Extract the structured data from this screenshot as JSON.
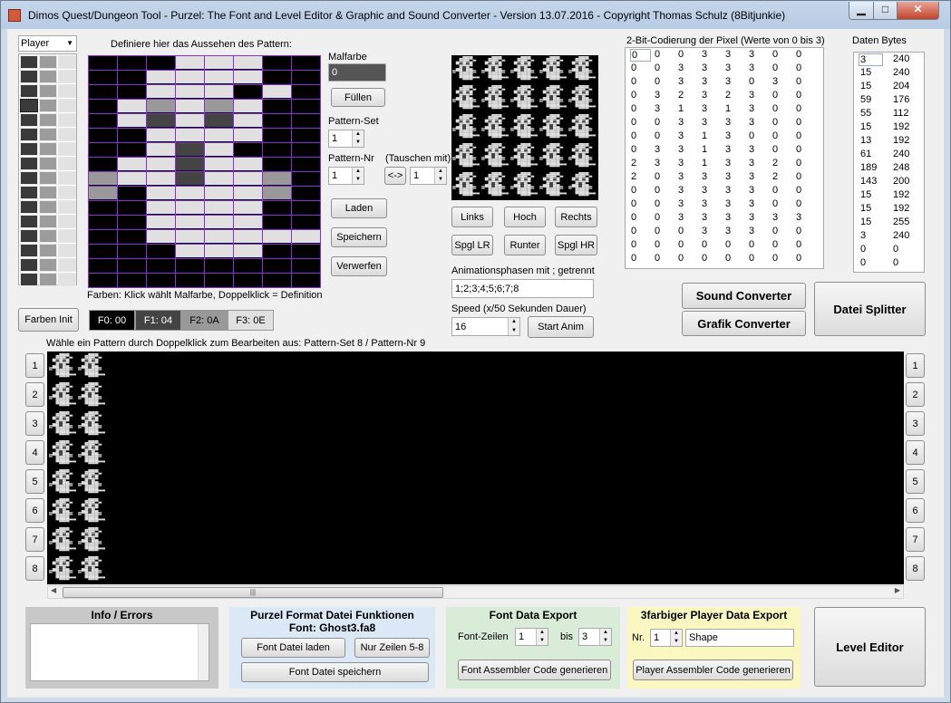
{
  "window": {
    "title": "Dimos Quest/Dungeon Tool  -  Purzel: The Font and Level Editor & Graphic and Sound Converter - Version 13.07.2016 - Copyright Thomas Schulz (8Bitjunkie)",
    "min_glyph": "▁",
    "max_glyph": "□",
    "close_glyph": "✕"
  },
  "player_select": {
    "value": "Player",
    "arrow": "▼"
  },
  "editor": {
    "heading": "Definiere hier das Aussehen des Pattern:",
    "colors_hint": "Farben: Klick wählt Malfarbe, Doppelklick = Definition",
    "grid_rows": [
      "00033300",
      "00333300",
      "00333030",
      "03232300",
      "03131300",
      "00333300",
      "00313000",
      "03313300",
      "23313320",
      "20333320",
      "00333300",
      "00333300",
      "00333333",
      "00033300",
      "00000000",
      "00000000"
    ]
  },
  "palette_colors": {
    "c0": "#000000",
    "c1": "#444444",
    "c2": "#999999",
    "c3": "#e0e0e0",
    "grid_line": "#8a2be2"
  },
  "controls": {
    "malfarbe_label": "Malfarbe",
    "malfarbe_value": "0",
    "fuellen": "Füllen",
    "pattern_set_label": "Pattern-Set",
    "pattern_set_value": "1",
    "pattern_nr_label": "Pattern-Nr",
    "pattern_nr_value": "1",
    "tauschen_label": "(Tauschen mit)",
    "swap_button": "<->",
    "swap_value": "1",
    "laden": "Laden",
    "speichern": "Speichern",
    "verwerfen": "Verwerfen",
    "farben_init": "Farben Init",
    "spin_up": "▲",
    "spin_down": "▼"
  },
  "color_buttons": [
    {
      "label": "F0: 00",
      "bg": "#000000",
      "fg": "#ffffff"
    },
    {
      "label": "F1: 04",
      "bg": "#444444",
      "fg": "#ffffff"
    },
    {
      "label": "F2: 0A",
      "bg": "#999999",
      "fg": "#000000"
    },
    {
      "label": "F3: 0E",
      "bg": "#e0e0e0",
      "fg": "#000000"
    }
  ],
  "shift_buttons": {
    "links": "Links",
    "hoch": "Hoch",
    "rechts": "Rechts",
    "spgl_lr": "Spgl LR",
    "runter": "Runter",
    "spgl_hr": "Spgl HR"
  },
  "animation": {
    "label": "Animationsphasen mit ; getrennt",
    "value": "1;2;3;4;5;6;7;8",
    "speed_label": "Speed (x/50 Sekunden Dauer)",
    "speed_value": "16",
    "start_button": "Start Anim"
  },
  "coding": {
    "heading": "2-Bit-Codierung der Pixel (Werte von 0 bis 3)",
    "rows": [
      [
        "0",
        "0",
        "0",
        "3",
        "3",
        "3",
        "0",
        "0"
      ],
      [
        "0",
        "0",
        "3",
        "3",
        "3",
        "3",
        "0",
        "0"
      ],
      [
        "0",
        "0",
        "3",
        "3",
        "3",
        "0",
        "3",
        "0"
      ],
      [
        "0",
        "3",
        "2",
        "3",
        "2",
        "3",
        "0",
        "0"
      ],
      [
        "0",
        "3",
        "1",
        "3",
        "1",
        "3",
        "0",
        "0"
      ],
      [
        "0",
        "0",
        "3",
        "3",
        "3",
        "3",
        "0",
        "0"
      ],
      [
        "0",
        "0",
        "3",
        "1",
        "3",
        "0",
        "0",
        "0"
      ],
      [
        "0",
        "3",
        "3",
        "1",
        "3",
        "3",
        "0",
        "0"
      ],
      [
        "2",
        "3",
        "3",
        "1",
        "3",
        "3",
        "2",
        "0"
      ],
      [
        "2",
        "0",
        "3",
        "3",
        "3",
        "3",
        "2",
        "0"
      ],
      [
        "0",
        "0",
        "3",
        "3",
        "3",
        "3",
        "0",
        "0"
      ],
      [
        "0",
        "0",
        "3",
        "3",
        "3",
        "3",
        "0",
        "0"
      ],
      [
        "0",
        "0",
        "3",
        "3",
        "3",
        "3",
        "3",
        "3"
      ],
      [
        "0",
        "0",
        "0",
        "3",
        "3",
        "3",
        "0",
        "0"
      ],
      [
        "0",
        "0",
        "0",
        "0",
        "0",
        "0",
        "0",
        "0"
      ],
      [
        "0",
        "0",
        "0",
        "0",
        "0",
        "0",
        "0",
        "0"
      ]
    ]
  },
  "bytes": {
    "heading": "Daten Bytes",
    "rows": [
      [
        "3",
        "240"
      ],
      [
        "15",
        "240"
      ],
      [
        "15",
        "204"
      ],
      [
        "59",
        "176"
      ],
      [
        "55",
        "112"
      ],
      [
        "15",
        "192"
      ],
      [
        "13",
        "192"
      ],
      [
        "61",
        "240"
      ],
      [
        "189",
        "248"
      ],
      [
        "143",
        "200"
      ],
      [
        "15",
        "192"
      ],
      [
        "15",
        "192"
      ],
      [
        "15",
        "255"
      ],
      [
        "3",
        "240"
      ],
      [
        "0",
        "0"
      ],
      [
        "0",
        "0"
      ]
    ]
  },
  "converters": {
    "sound": "Sound Converter",
    "grafik": "Grafik Converter",
    "datei_splitter": "Datei Splitter"
  },
  "pattern_area": {
    "heading": "Wähle ein Pattern durch Doppelklick zum Bearbeiten aus:  Pattern-Set 8  /  Pattern-Nr 9",
    "row_labels": [
      "1",
      "2",
      "3",
      "4",
      "5",
      "6",
      "7",
      "8"
    ],
    "scroll_left": "◀",
    "scroll_right": "▶",
    "scroll_grip": "|||"
  },
  "info_panel": {
    "title": "Info / Errors"
  },
  "purzel_panel": {
    "title": "Purzel Format Datei Funktionen",
    "font_line": "Font: Ghost3.fa8",
    "font_laden": "Font Datei laden",
    "nur_zeilen": "Nur Zeilen 5-8",
    "font_speichern": "Font Datei speichern"
  },
  "font_export": {
    "title": "Font Data Export",
    "zeilen_label": "Font-Zeilen",
    "from_value": "1",
    "bis_label": "bis",
    "to_value": "3",
    "generate": "Font Assembler Code generieren"
  },
  "player_export": {
    "title": "3farbiger Player Data Export",
    "nr_label": "Nr.",
    "nr_value": "1",
    "shape_value": "Shape",
    "generate": "Player Assembler Code generieren"
  },
  "level_editor": "Level Editor"
}
